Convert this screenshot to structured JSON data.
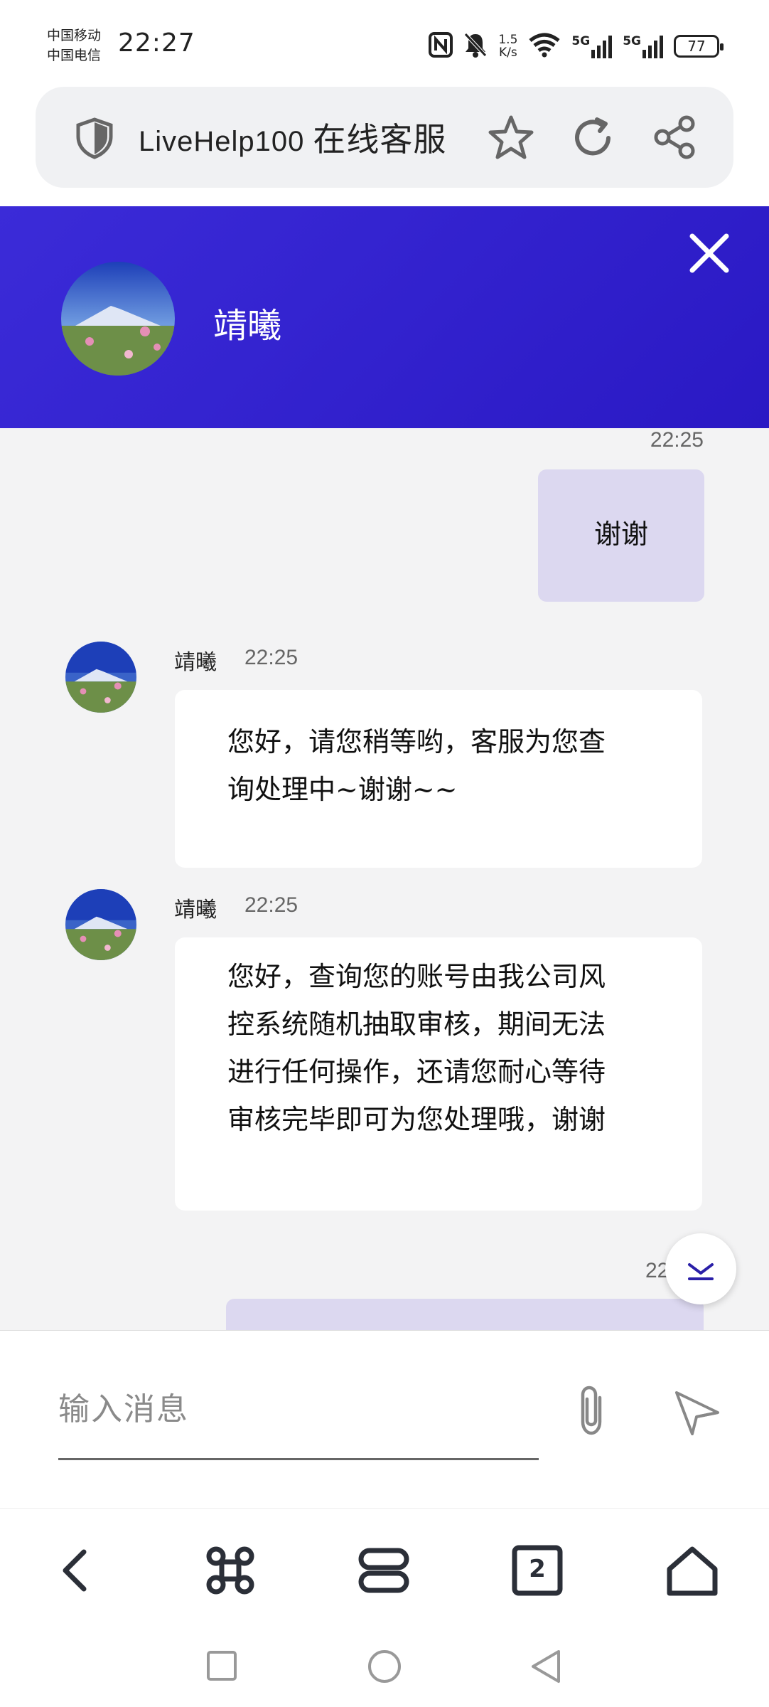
{
  "status_bar": {
    "carrier_1": "中国移动",
    "carrier_2": "中国电信",
    "time": "22:27",
    "speed_value": "1.5",
    "speed_unit": "K/s",
    "network_1": "5G",
    "network_2": "5G",
    "battery": "77"
  },
  "browser": {
    "site_name": "LiveHelp100",
    "site_label": "在线客服"
  },
  "chat_header": {
    "agent_name": "靖曦"
  },
  "messages": [
    {
      "type": "outgoing",
      "time": "22:25",
      "text": "谢谢"
    },
    {
      "type": "incoming",
      "sender": "靖曦",
      "time": "22:25",
      "lines": [
        "您好，请您稍等哟，客服为您查",
        "询处理中~谢谢~~"
      ]
    },
    {
      "type": "incoming",
      "sender": "靖曦",
      "time": "22:25",
      "lines": [
        "您好，查询您的账号由我公司风",
        "控系统随机抽取审核，期间无法",
        "进行任何操作，还请您耐心等待",
        "审核完毕即可为您处理哦，谢谢"
      ]
    },
    {
      "type": "outgoing",
      "time": "22"
    }
  ],
  "composer": {
    "placeholder": "输入消息"
  },
  "bottom_nav": {
    "tab_count": "2"
  },
  "colors": {
    "header": "#3b2bd8",
    "outgoing_bubble": "#dcd8f0",
    "chat_background": "#f3f3f4"
  }
}
